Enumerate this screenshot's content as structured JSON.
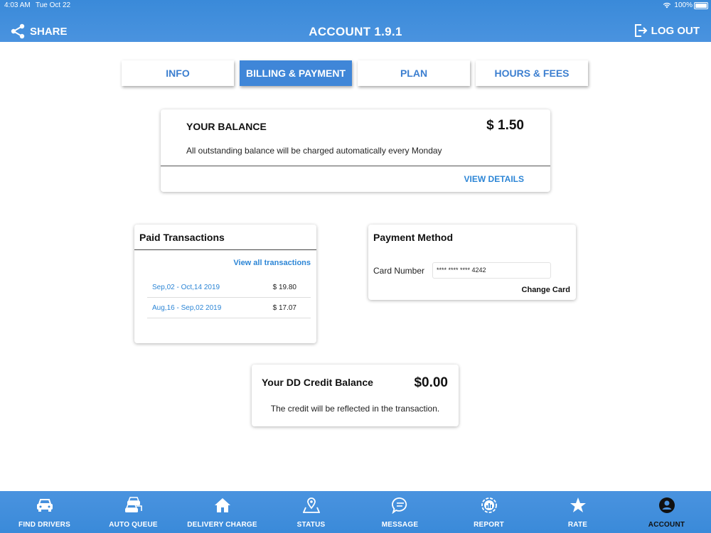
{
  "status_bar": {
    "time": "4:03 AM",
    "date": "Tue Oct 22",
    "battery": "100%"
  },
  "header": {
    "share_label": "SHARE",
    "title": "ACCOUNT 1.9.1",
    "logout_label": "LOG OUT"
  },
  "tabs": [
    {
      "label": "INFO",
      "active": false
    },
    {
      "label": "BILLING & PAYMENT",
      "active": true
    },
    {
      "label": "PLAN",
      "active": false
    },
    {
      "label": "HOURS & FEES",
      "active": false
    }
  ],
  "balance": {
    "label": "YOUR BALANCE",
    "amount": "$ 1.50",
    "note": "All outstanding balance will be charged automatically every Monday",
    "view_details": "VIEW DETAILS"
  },
  "paid_transactions": {
    "title": "Paid Transactions",
    "view_all": "View all transactions",
    "rows": [
      {
        "range": "Sep,02 - Oct,14 2019",
        "amount": "$ 19.80"
      },
      {
        "range": "Aug,16 - Sep,02 2019",
        "amount": "$ 17.07"
      }
    ]
  },
  "payment_method": {
    "title": "Payment Method",
    "card_label": "Card Number",
    "card_value": "**** **** **** 4242",
    "change_card": "Change Card"
  },
  "credit": {
    "label": "Your DD Credit Balance",
    "amount": "$0.00",
    "note": "The credit will be reflected in the transaction."
  },
  "bottom_nav": [
    {
      "label": "FIND DRIVERS",
      "icon": "car-icon"
    },
    {
      "label": "AUTO QUEUE",
      "icon": "cars-queue-icon"
    },
    {
      "label": "DELIVERY CHARGE",
      "icon": "home-icon"
    },
    {
      "label": "STATUS",
      "icon": "map-pin-icon"
    },
    {
      "label": "MESSAGE",
      "icon": "chat-bubble-icon"
    },
    {
      "label": "REPORT",
      "icon": "report-chart-icon"
    },
    {
      "label": "RATE",
      "icon": "star-icon"
    },
    {
      "label": "ACCOUNT",
      "icon": "account-icon",
      "active": true
    }
  ],
  "colors": {
    "header_blue": "#3a8ad9",
    "link_blue": "#2d86d6",
    "active_tab": "#3f86d8"
  }
}
